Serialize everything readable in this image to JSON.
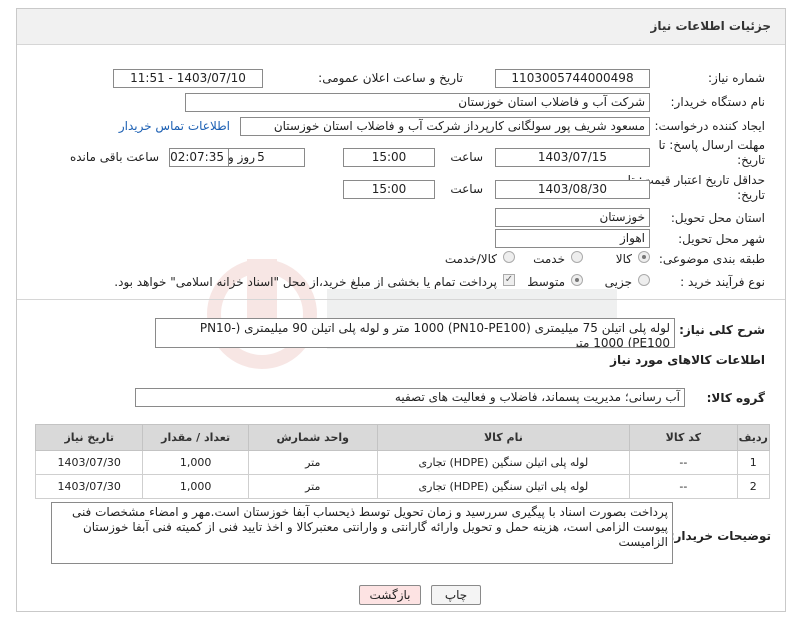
{
  "page": {
    "title": "جزئیات اطلاعات نیاز"
  },
  "form": {
    "need_number_label": "شماره نیاز:",
    "need_number": "1103005744000498",
    "announce_label": "تاریخ و ساعت اعلان عمومی:",
    "announce_value": "1403/07/10 - 11:51",
    "buyer_label": "نام دستگاه خریدار:",
    "buyer_value": "شرکت آب و فاضلاب استان خوزستان",
    "creator_label": "ایجاد کننده درخواست:",
    "creator_value": "مسعود شریف پور سولگانی کارپرداز شرکت آب و فاضلاب استان خوزستان",
    "contact_link": "اطلاعات تماس خریدار",
    "deadline_label_1": "مهلت ارسال پاسخ: تا",
    "deadline_label_2": "تاریخ:",
    "deadline_date": "1403/07/15",
    "time_label": "ساعت",
    "deadline_time": "15:00",
    "days_value": "5",
    "days_label": "روز و",
    "remaining_value": "02:07:35",
    "remaining_label": "ساعت باقی مانده",
    "validity_label_1": "حداقل تاریخ اعتبار قیمت: تا",
    "validity_label_2": "تاریخ:",
    "validity_date": "1403/08/30",
    "validity_time": "15:00",
    "province_label": "استان محل تحویل:",
    "province_value": "خوزستان",
    "city_label": "شهر محل تحویل:",
    "city_value": "اهواز",
    "category_label": "طبقه بندی موضوعی:",
    "cat_goods": "کالا",
    "cat_service": "خدمت",
    "cat_both": "کالا/خدمت",
    "process_label": "نوع فرآیند خرید :",
    "proc_partial": "جزیی",
    "proc_medium": "متوسط",
    "payment_text": "پرداخت تمام یا بخشی از مبلغ خرید،از محل \"اسناد خزانه اسلامی\" خواهد بود."
  },
  "summary": {
    "label": "شرح کلی نیاز:",
    "text": "لوله پلی اتیلن 75 میلیمتری (PN10-PE100) 1000 متر  و لوله پلی اتیلن 90 میلیمتری (PN10-PE100) 1000 متر"
  },
  "goods_section": {
    "title": "اطلاعات کالاهای مورد نیاز",
    "group_label": "گروه کالا:",
    "group_value": "آب رسانی؛ مدیریت پسماند، فاضلاب و فعالیت های تصفیه"
  },
  "table": {
    "headers": [
      "ردیف",
      "کد کالا",
      "نام کالا",
      "واحد شمارش",
      "تعداد / مقدار",
      "تاریخ نیاز"
    ],
    "rows": [
      [
        "1",
        "--",
        "لوله پلی اتیلن سنگین (HDPE) تجاری",
        "متر",
        "1,000",
        "1403/07/30"
      ],
      [
        "2",
        "--",
        "لوله پلی اتیلن سنگین (HDPE) تجاری",
        "متر",
        "1,000",
        "1403/07/30"
      ]
    ]
  },
  "buyer_notes": {
    "label": "توضیحات خریدار:",
    "text": "پرداخت بصورت اسناد با پیگیری  سررسید و زمان تحویل توسط ذیحساب آبفا خوزستان است.مهر و امضاء مشخصات فنی پیوست الزامی است، هزینه حمل و تحویل وارائه گارانتی و وارانتی معتبرکالا و اخذ تایید فنی از کمیته فنی آبفا خوزستان الزامیست"
  },
  "buttons": {
    "print": "چاپ",
    "back": "بازگشت"
  },
  "colors": {
    "link": "#1b5fb3",
    "header_bg": "#f1f1f1",
    "back_bg": "#fde3e3",
    "table_head": "#d9d9d9"
  }
}
